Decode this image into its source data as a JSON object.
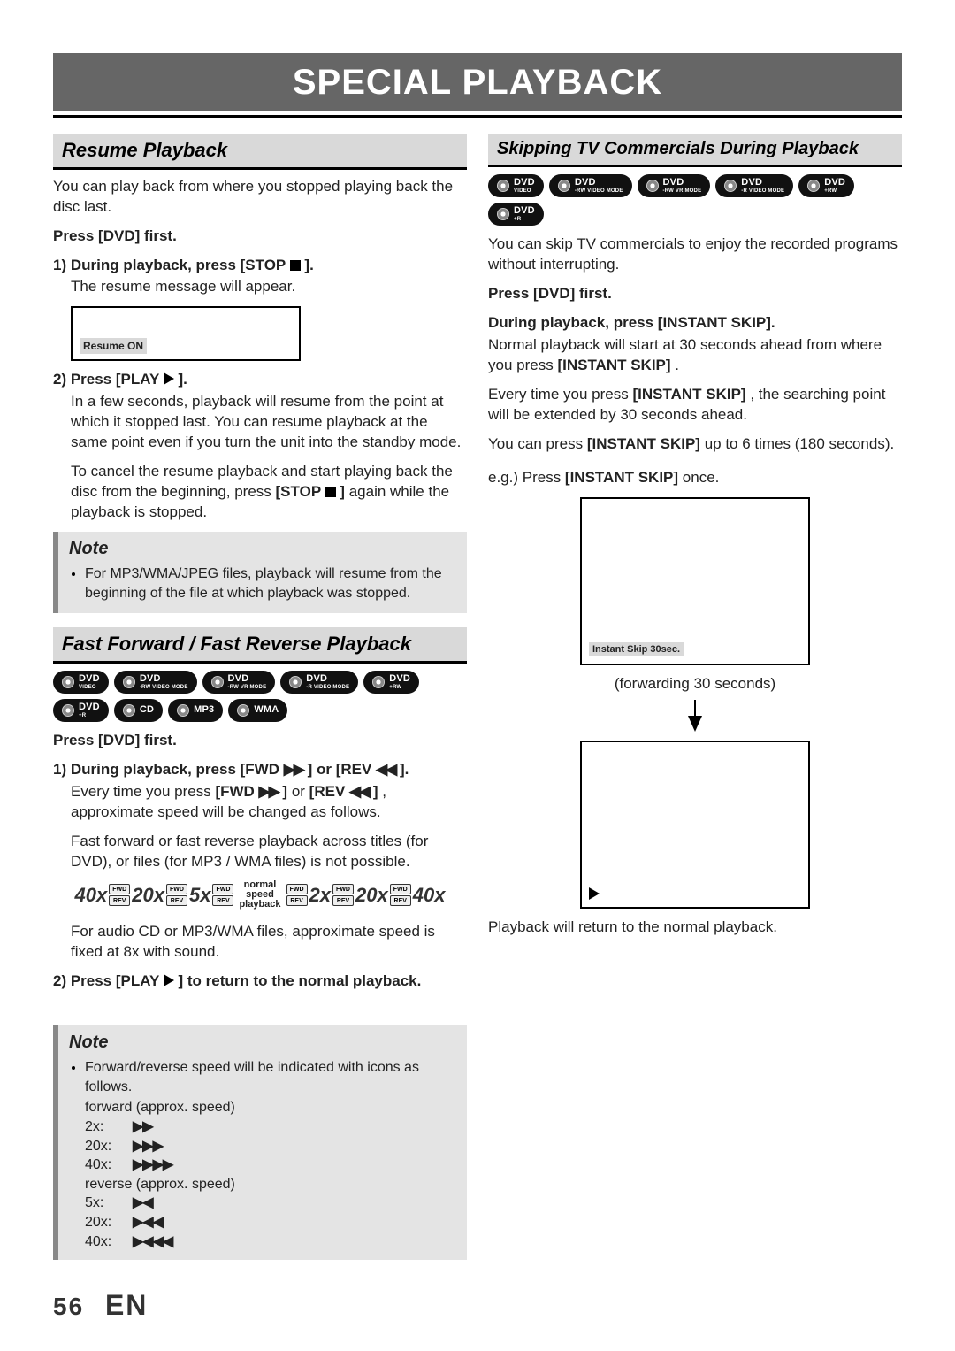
{
  "page_title": "SPECIAL PLAYBACK",
  "page_number": "56",
  "lang": "EN",
  "resume": {
    "heading": "Resume Playback",
    "intro": "You can play back from where you stopped playing back the disc last.",
    "press_first": "Press [DVD] first.",
    "step1_lead": "1) During playback, press [STOP ",
    "step1_tail": " ].",
    "step1_body": "The resume message will appear.",
    "resume_msg": "Resume ON",
    "step2_lead": "2) Press [PLAY ",
    "step2_tail": " ].",
    "step2_body": "In a few seconds, playback will resume from the point at which it stopped last. You can resume playback at the same point even if you turn the unit into the standby mode.",
    "step2_body2a": "To cancel the resume playback and start playing back the disc from the beginning, press ",
    "step2_body2_btn": "[STOP ",
    "step2_body2_btn_tail": " ]",
    "step2_body2b": " again while the playback is stopped."
  },
  "resume_note": {
    "title": "Note",
    "item": "For MP3/WMA/JPEG files, playback will resume from the beginning of the file at which playback was stopped."
  },
  "ff": {
    "heading": "Fast Forward / Fast Reverse Playback",
    "badges": [
      {
        "top": "DVD",
        "bot": "VIDEO"
      },
      {
        "top": "DVD",
        "bot": "-RW VIDEO MODE"
      },
      {
        "top": "DVD",
        "bot": "-RW VR MODE"
      },
      {
        "top": "DVD",
        "bot": "-R VIDEO MODE"
      },
      {
        "top": "DVD",
        "bot": "+RW"
      },
      {
        "top": "DVD",
        "bot": "+R"
      },
      {
        "top": "CD",
        "bot": ""
      },
      {
        "top": "MP3",
        "bot": ""
      },
      {
        "top": "WMA",
        "bot": ""
      }
    ],
    "press_first": "Press [DVD] first.",
    "step1_lead": "1) During playback, press [FWD ",
    "step1_mid": " ] or [REV ",
    "step1_tail": " ].",
    "step1_body_a": "Every time you press ",
    "step1_body_fwd": "[FWD ",
    "step1_body_fwdtail": " ]",
    "step1_body_or": " or ",
    "step1_body_rev": "[REV ",
    "step1_body_revtail": " ]",
    "step1_body_b": ", approximate speed will be changed as follows.",
    "step1_note": "Fast forward or fast reverse playback across titles (for DVD), or files (for MP3 / WMA files) is not possible.",
    "speeds_rev": [
      "40x",
      "20x",
      "5x"
    ],
    "center_line1": "normal",
    "center_line2": "speed",
    "center_line3": "playback",
    "speeds_fwd": [
      "2x",
      "20x",
      "40x"
    ],
    "btn_fwd": "FWD",
    "btn_rev": "REV",
    "audio_note": "For audio CD or MP3/WMA files, approximate speed is fixed at 8x with sound.",
    "step2": "2) Press [PLAY ",
    "step2_tail": " ] to return to the normal playback."
  },
  "ff_note": {
    "title": "Note",
    "lead": "Forward/reverse speed will be indicated with icons as follows.",
    "fwd_label": "forward (approx. speed)",
    "rev_label": "reverse (approx. speed)",
    "rows_fwd": [
      {
        "label": "2x:",
        "icon": "▶▶"
      },
      {
        "label": "20x:",
        "icon": "▶▶▶"
      },
      {
        "label": "40x:",
        "icon": "▶▶▶▶"
      }
    ],
    "rows_rev": [
      {
        "label": "5x:",
        "icon": "▶◀"
      },
      {
        "label": "20x:",
        "icon": "▶◀◀"
      },
      {
        "label": "40x:",
        "icon": "▶◀◀◀"
      }
    ]
  },
  "skip": {
    "heading": "Skipping TV Commercials During Playback",
    "badges": [
      {
        "top": "DVD",
        "bot": "VIDEO"
      },
      {
        "top": "DVD",
        "bot": "-RW VIDEO MODE"
      },
      {
        "top": "DVD",
        "bot": "-RW VR MODE"
      },
      {
        "top": "DVD",
        "bot": "-R VIDEO MODE"
      },
      {
        "top": "DVD",
        "bot": "+RW"
      },
      {
        "top": "DVD",
        "bot": "+R"
      }
    ],
    "intro": "You can skip TV commercials to enjoy the recorded programs without interrupting.",
    "press_first": "Press [DVD] first.",
    "step1": "During playback, press [INSTANT SKIP].",
    "step1_body_a": "Normal playback will start at 30 seconds ahead from where you press ",
    "step1_body_btn": "[INSTANT SKIP]",
    "step1_body_b": ".",
    "para2_a": "Every time you press ",
    "para2_btn": "[INSTANT SKIP]",
    "para2_b": ", the searching point will be extended by 30 seconds ahead.",
    "para3_a": "You can press ",
    "para3_btn": "[INSTANT SKIP]",
    "para3_b": " up to 6 times (180 seconds).",
    "eg_a": "e.g.) Press ",
    "eg_btn": "[INSTANT SKIP]",
    "eg_b": " once.",
    "tv_msg": "Instant Skip 30sec.",
    "caption": "(forwarding 30 seconds)",
    "outro": "Playback will return to the normal playback."
  }
}
